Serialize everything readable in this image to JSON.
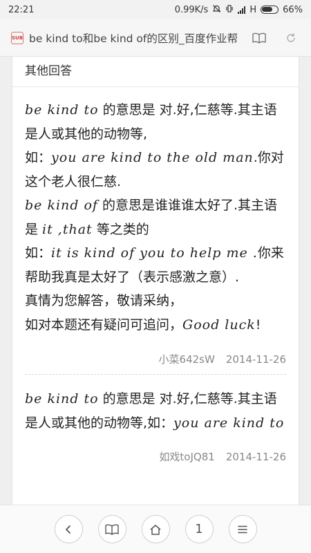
{
  "status_bar": {
    "time": "22:21",
    "network_speed": "0.99K/s",
    "network_type": "H",
    "battery_percent": "66%"
  },
  "browser": {
    "page_title": "be kind to和be kind of的区别_百度作业帮",
    "favicon_text": "SUB"
  },
  "section": {
    "title": "其他回答"
  },
  "answers": [
    {
      "segments": [
        {
          "t": "be kind to",
          "en": true
        },
        {
          "t": " 的意思是 对.好,仁慈等.其主语是人或其他的动物等,",
          "en": false
        },
        {
          "br": true
        },
        {
          "t": "如：",
          "en": false
        },
        {
          "t": "you are kind to the old man",
          "en": true
        },
        {
          "t": ".你对这个老人很仁慈.",
          "en": false
        },
        {
          "br": true
        },
        {
          "t": "be kind of",
          "en": true
        },
        {
          "t": " 的意思是谁谁谁太好了.其主语是 ",
          "en": false
        },
        {
          "t": "it ,that",
          "en": true
        },
        {
          "t": " 等之类的",
          "en": false
        },
        {
          "br": true
        },
        {
          "t": "如：",
          "en": false
        },
        {
          "t": "it is kind of you to help me .",
          "en": true
        },
        {
          "t": "你来帮助我真是太好了（表示感激之意）.",
          "en": false
        },
        {
          "br": true
        },
        {
          "t": "真情为您解答，敬请采纳，",
          "en": false
        },
        {
          "br": true
        },
        {
          "t": "如对本题还有疑问可追问，",
          "en": false
        },
        {
          "t": "Good luck",
          "en": true
        },
        {
          "t": "!",
          "en": false
        }
      ],
      "author": "小菜642sW",
      "date": "2014-11-26"
    },
    {
      "segments": [
        {
          "t": "be kind to",
          "en": true
        },
        {
          "t": " 的意思是 对.好,仁慈等.其主语是人或其他的动物等,如：",
          "en": false
        },
        {
          "t": "you are kind to",
          "en": true
        }
      ],
      "author": "如戏toJQ81",
      "date": "2014-11-26"
    }
  ],
  "icons": {
    "status": [
      "mute-icon",
      "vibrate-icon",
      "signal-icon",
      "battery-icon"
    ],
    "address": [
      "reader-mode-icon",
      "refresh-icon"
    ],
    "nav": [
      "back-icon",
      "bookmarks-icon",
      "home-icon",
      "tabs-icon",
      "menu-icon"
    ]
  },
  "bottom_nav": {
    "tab_count": "1"
  }
}
